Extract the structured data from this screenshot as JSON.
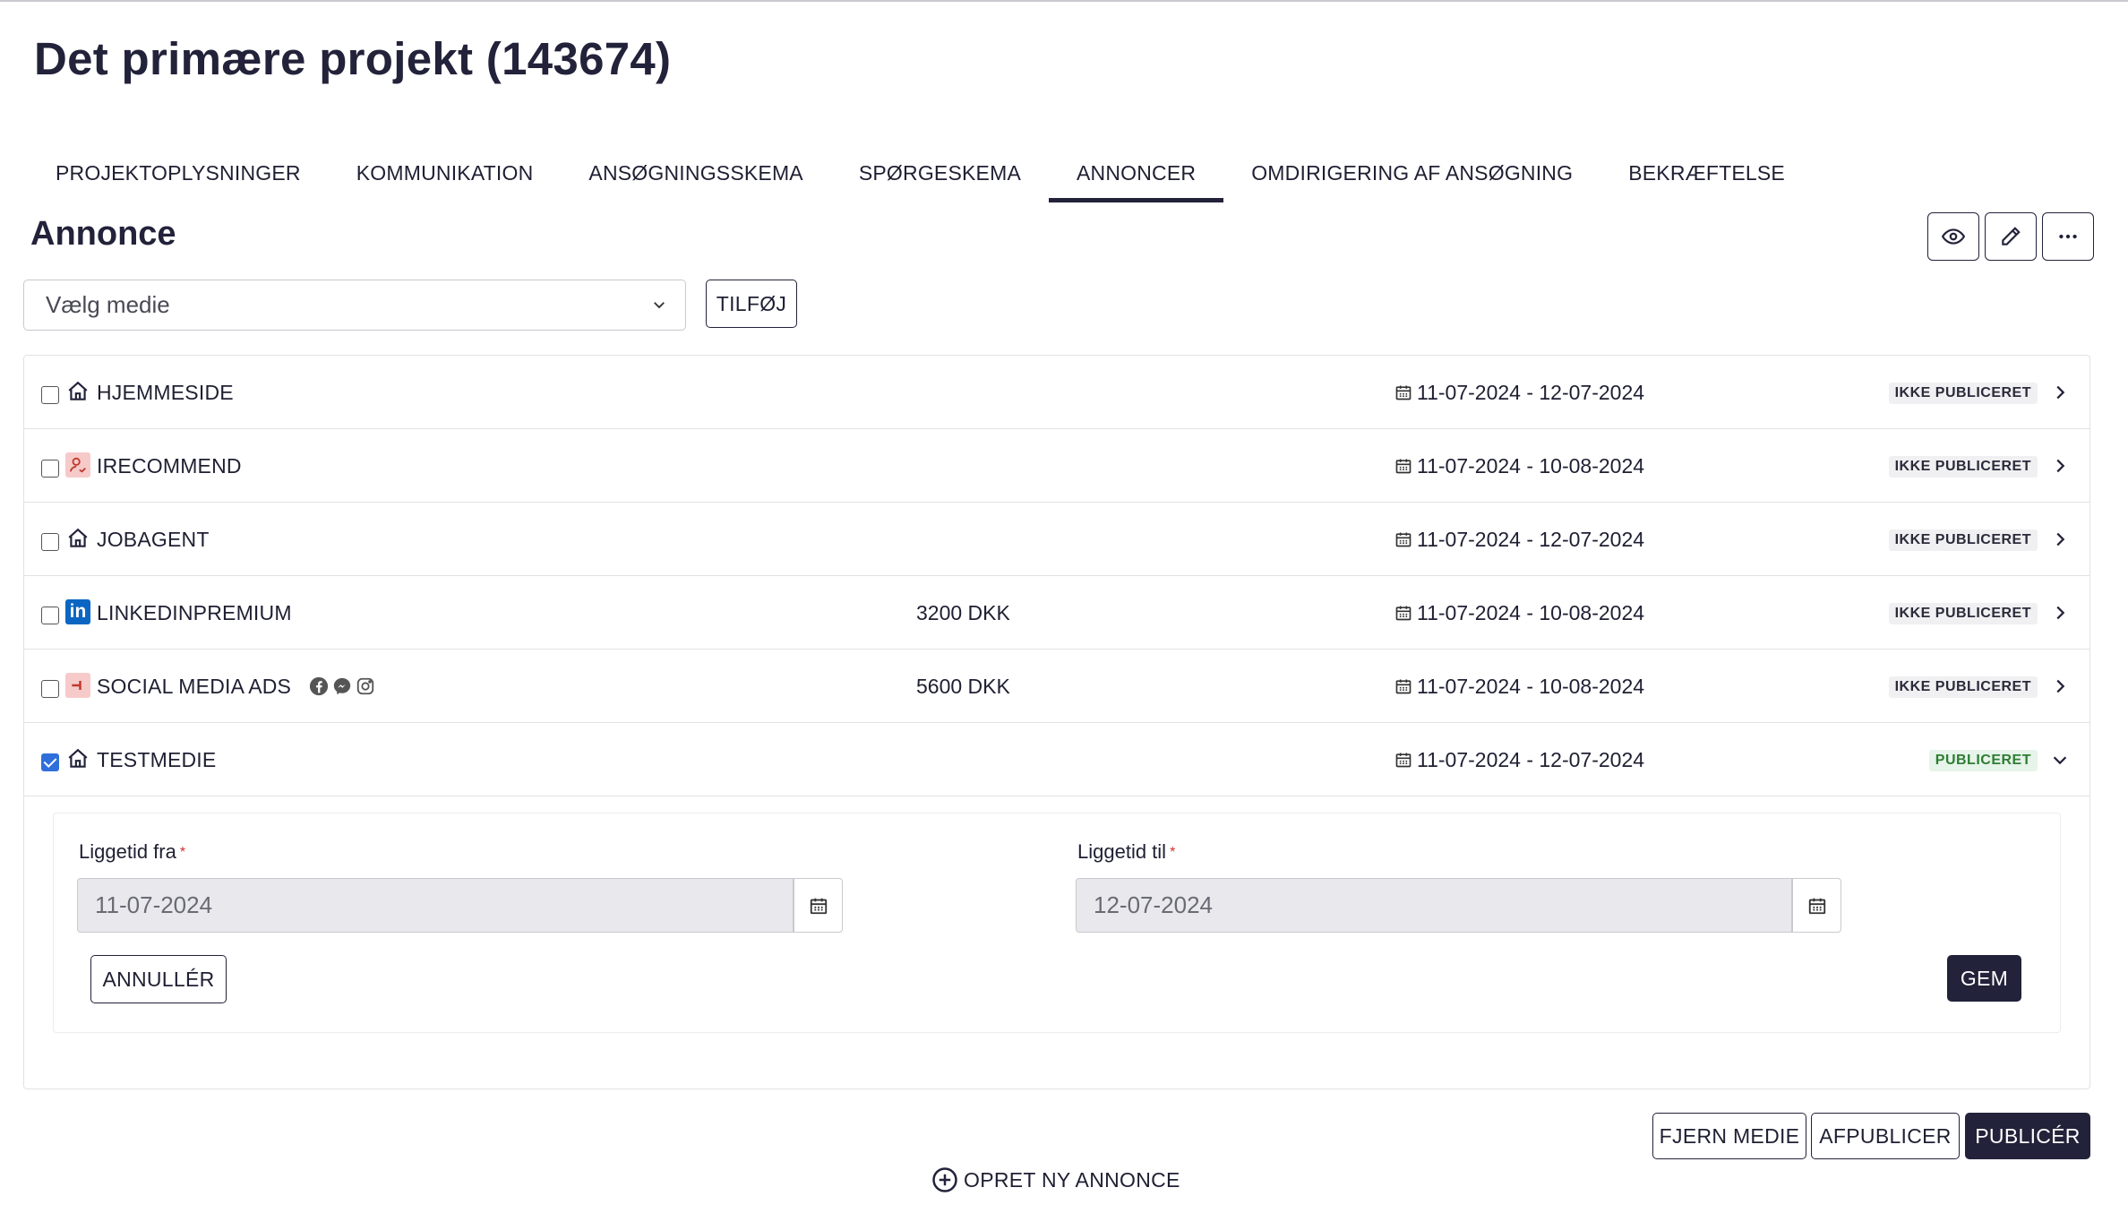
{
  "page": {
    "title": "Det primære projekt (143674)"
  },
  "tabs": [
    {
      "label": "PROJEKTOPLYSNINGER",
      "active": false
    },
    {
      "label": "KOMMUNIKATION",
      "active": false
    },
    {
      "label": "ANSØGNINGSSKEMA",
      "active": false
    },
    {
      "label": "SPØRGESKEMA",
      "active": false
    },
    {
      "label": "ANNONCER",
      "active": true
    },
    {
      "label": "OMDIRIGERING AF ANSØGNING",
      "active": false
    },
    {
      "label": "BEKRÆFTELSE",
      "active": false
    }
  ],
  "section": {
    "title": "Annonce"
  },
  "toolbar": {
    "view_icon": "eye-icon",
    "edit_icon": "pencil-icon",
    "more_icon": "more-horizontal-icon"
  },
  "media_select": {
    "placeholder": "Vælg medie",
    "add_label": "TILFØJ"
  },
  "media": [
    {
      "name": "HJEMMESIDE",
      "icon": "home-icon",
      "price": "",
      "dates": "11-07-2024 - 12-07-2024",
      "status": "IKKE PUBLICERET",
      "checked": false,
      "expanded": false
    },
    {
      "name": "IRECOMMEND",
      "icon": "irecommend-icon",
      "price": "",
      "dates": "11-07-2024 - 10-08-2024",
      "status": "IKKE PUBLICERET",
      "checked": false,
      "expanded": false
    },
    {
      "name": "JOBAGENT",
      "icon": "home-icon",
      "price": "",
      "dates": "11-07-2024 - 12-07-2024",
      "status": "IKKE PUBLICERET",
      "checked": false,
      "expanded": false
    },
    {
      "name": "LINKEDINPREMIUM",
      "icon": "linkedin-icon",
      "price": "3200 DKK",
      "dates": "11-07-2024 - 10-08-2024",
      "status": "IKKE PUBLICERET",
      "checked": false,
      "expanded": false
    },
    {
      "name": "SOCIAL MEDIA ADS",
      "icon": "social-media-ads-icon",
      "price": "5600 DKK",
      "dates": "11-07-2024 - 10-08-2024",
      "status": "IKKE PUBLICERET",
      "checked": false,
      "expanded": false,
      "channels": [
        "facebook-icon",
        "messenger-icon",
        "instagram-icon"
      ]
    },
    {
      "name": "TESTMEDIE",
      "icon": "home-icon",
      "price": "",
      "dates": "11-07-2024 - 12-07-2024",
      "status": "PUBLICERET",
      "checked": true,
      "expanded": true
    }
  ],
  "detail": {
    "from_label": "Liggetid fra",
    "from_value": "11-07-2024",
    "to_label": "Liggetid til",
    "to_value": "12-07-2024",
    "required_marker": "*",
    "cancel_label": "ANNULLÉR",
    "save_label": "GEM"
  },
  "actions": {
    "remove_label": "FJERN MEDIE",
    "unpublish_label": "AFPUBLICER",
    "publish_label": "PUBLICÉR"
  },
  "create": {
    "label": "OPRET NY ANNONCE",
    "icon": "plus-circle-icon"
  },
  "colors": {
    "primary": "#22223a",
    "checkbox": "#2f6fdb",
    "required": "#d32f2f",
    "published_badge": "#e6f4ea",
    "linkedin": "#0a66c2"
  }
}
